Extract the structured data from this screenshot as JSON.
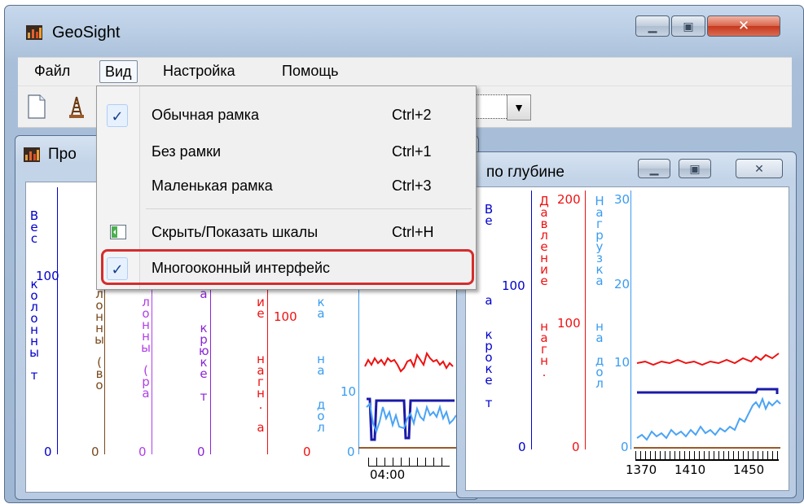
{
  "window": {
    "title": "GeoSight"
  },
  "menubar": {
    "items": [
      "Файл",
      "Вид",
      "Настройка",
      "Помощь"
    ]
  },
  "view_menu": {
    "items": [
      {
        "label": "Обычная рамка",
        "shortcut": "Ctrl+2",
        "checked": true
      },
      {
        "label": "Без рамки",
        "shortcut": "Ctrl+1",
        "checked": false
      },
      {
        "label": "Маленькая рамка",
        "shortcut": "Ctrl+3",
        "checked": false
      },
      {
        "label": "Скрыть/Показать шкалы",
        "shortcut": "Ctrl+H",
        "checked": false,
        "icon": "scales-icon"
      },
      {
        "label": "Многооконный интерфейс",
        "shortcut": "",
        "checked": true,
        "highlighted": true
      }
    ]
  },
  "left_window": {
    "title_visible": "Про",
    "scales": [
      {
        "name_chars": "Вес колонны т",
        "color": "#0000cc",
        "ticks": [
          "100",
          "0"
        ]
      },
      {
        "name_chars": "Вес колонны (во",
        "color": "#7a4a1e",
        "ticks": [
          "0"
        ]
      },
      {
        "name_chars": "лонны (ра",
        "color": "#b040e8",
        "ticks": [
          "0"
        ]
      },
      {
        "name_chars": "а крюке т",
        "color": "#8a25d6",
        "ticks": [
          "0"
        ]
      },
      {
        "name_chars": "ие нагн. а",
        "color": "#ee1111",
        "ticks": [
          "100",
          "0"
        ]
      },
      {
        "name_chars": "ка нагн. дол",
        "color": "#3a9cf0",
        "ticks": [
          "10",
          "0"
        ]
      }
    ],
    "time_label": "04:00"
  },
  "right_window": {
    "title_visible": "по глубине",
    "scales": [
      {
        "name_chars": "Ве а кроке т",
        "color": "#0000cc",
        "ticks": [
          "100",
          "0"
        ]
      },
      {
        "name_chars": "Давление нагн.",
        "color": "#ee1111",
        "ticks": [
          "200",
          "100",
          "0"
        ]
      },
      {
        "name_chars": "Нагрузка на дол",
        "color": "#3a9cf0",
        "ticks": [
          "30",
          "20",
          "10",
          "0"
        ]
      }
    ],
    "x_ticks": [
      "1370",
      "1410",
      "1450"
    ]
  },
  "colors": {
    "red": "#ee1111",
    "blue": "#1a1aa8",
    "lightblue": "#4aa4f5",
    "brown": "#9a5a2a"
  }
}
